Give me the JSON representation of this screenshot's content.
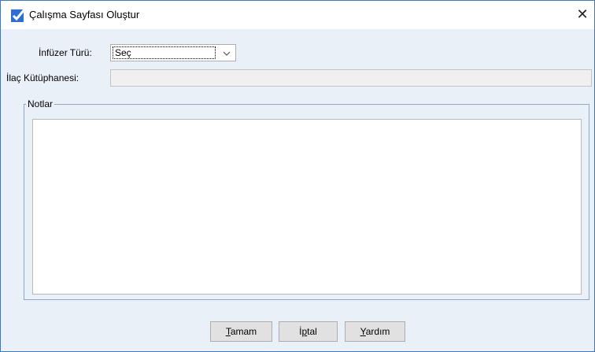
{
  "window": {
    "title": "Çalışma Sayfası Oluştur",
    "close_glyph": "✕"
  },
  "form": {
    "infuser_type_label": "İnfüzer Türü:",
    "infuser_type_value": "Seç",
    "drug_library_label": "İlaç Kütüphanesi:",
    "drug_library_value": "",
    "notes_label": "Notlar",
    "notes_value": ""
  },
  "buttons": {
    "ok": {
      "mnemonic": "T",
      "rest": "amam"
    },
    "cancel": {
      "pre": "İ",
      "mnemonic": "p",
      "rest": "tal"
    },
    "help": {
      "mnemonic": "Y",
      "rest": "ardım"
    }
  },
  "colors": {
    "accent": "#2c6fd1",
    "border": "#3b78c4",
    "background": "#eaf0f7"
  }
}
